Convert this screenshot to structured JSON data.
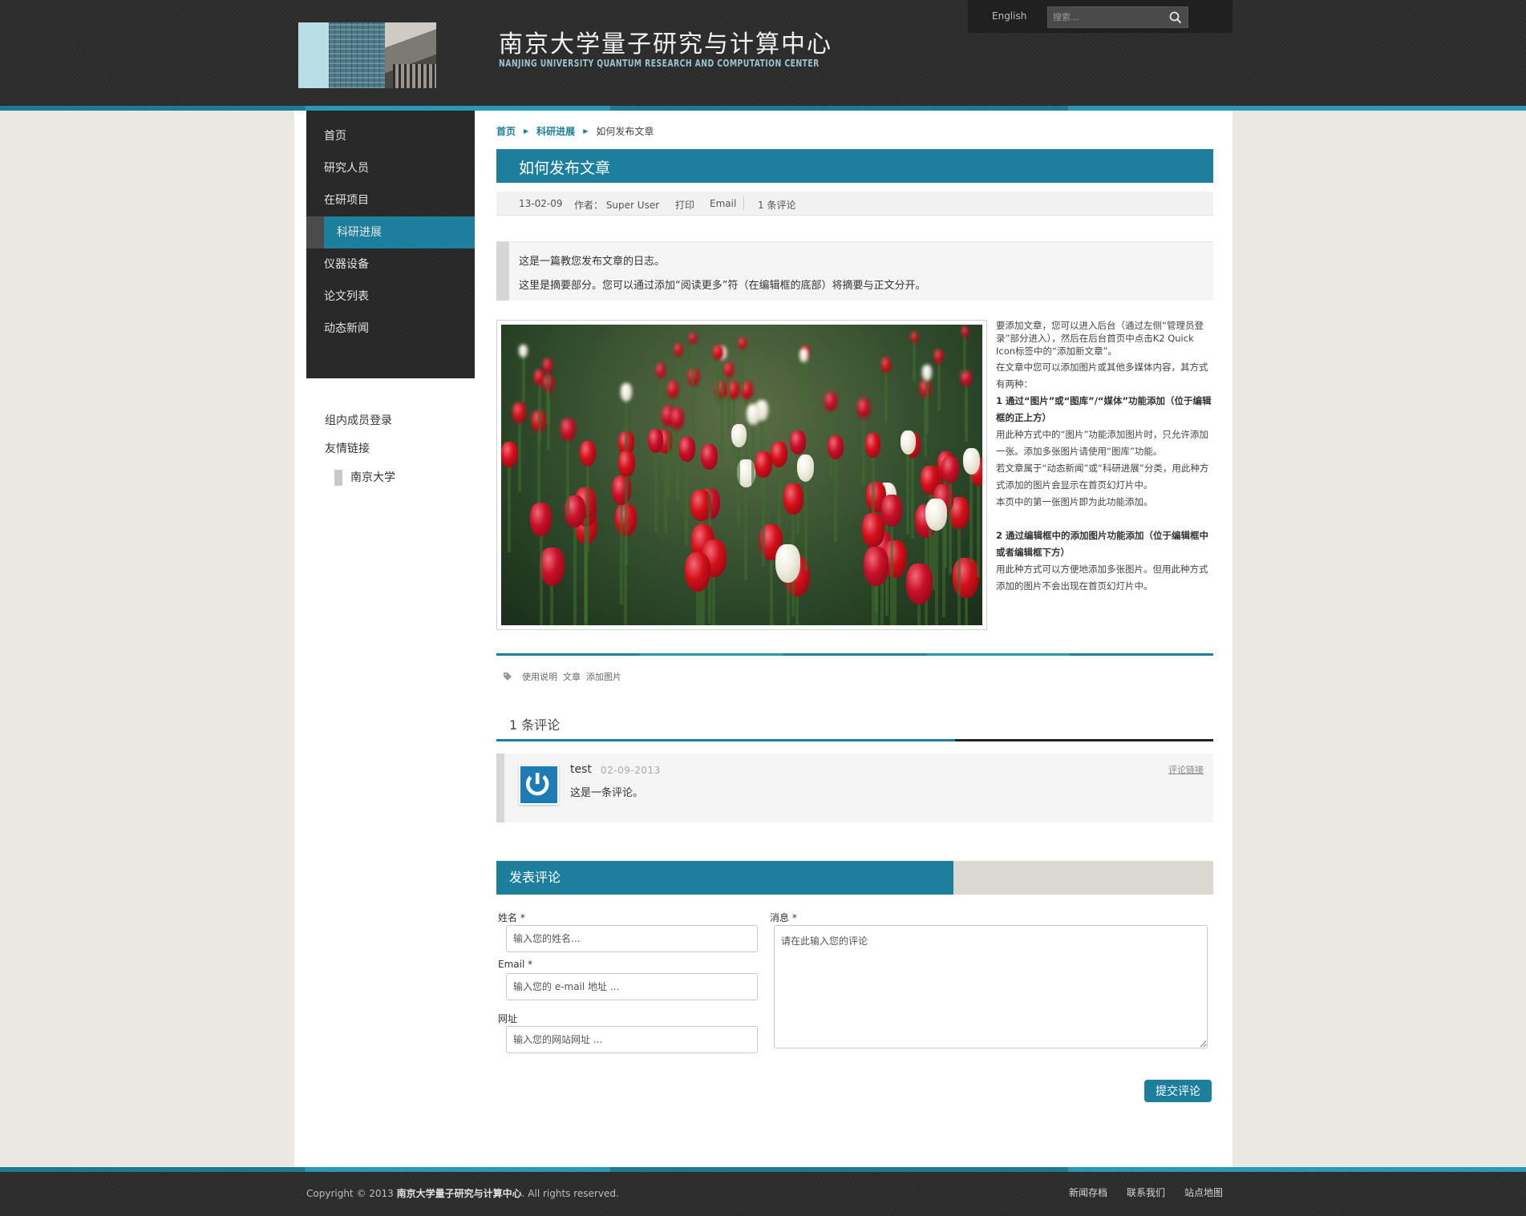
{
  "header": {
    "title": "南京大学量子研究与计算中心",
    "subtitle": "NANJING UNIVERSITY QUANTUM RESEARCH AND COMPUTATION CENTER",
    "lang_link": "English",
    "search_placeholder": "搜索..."
  },
  "sidebar": {
    "items": [
      {
        "label": "首页"
      },
      {
        "label": "研究人员"
      },
      {
        "label": "在研项目"
      },
      {
        "label": "科研进展",
        "active": true
      },
      {
        "label": "仪器设备"
      },
      {
        "label": "论文列表"
      },
      {
        "label": "动态新闻"
      }
    ],
    "links": [
      "组内成员登录",
      "友情链接"
    ],
    "sublink": "南京大学"
  },
  "breadcrumb": {
    "home": "首页",
    "section": "科研进展",
    "current": "如何发布文章"
  },
  "article": {
    "title": "如何发布文章",
    "date": "13-02-09",
    "author": "作者： Super User",
    "print": "打印",
    "email": "Email",
    "comments_count": "1 条评论",
    "intro_line1": "这是一篇教您发布文章的日志。",
    "intro_line2": "这里是摘要部分。您可以通过添加“阅读更多”符（在编辑框的底部）将摘要与正文分开。",
    "body": [
      "要添加文章，您可以进入后台（通过左侧“管理员登录”部分进入），然后在后台首页中点击K2 Quick Icon标签中的“添加新文章”。",
      "在文章中您可以添加图片或其他多媒体内容，其方式有两种：",
      "1 通过“图片”或“图库”/“媒体”功能添加（位于编辑框的正上方）",
      "用此种方式中的“图片”功能添加图片时，只允许添加一张。添加多张图片请使用“图库”功能。",
      "若文章属于“动态新闻”或“科研进展”分类，用此种方式添加的图片会显示在首页幻灯片中。",
      "本页中的第一张图片即为此功能添加。",
      "2 通过编辑框中的添加图片功能添加（位于编辑框中或者编辑框下方）",
      "用此种方式可以方便地添加多张图片。但用此种方式添加的图片不会出现在首页幻灯片中。"
    ],
    "tags": [
      "使用说明",
      "文章",
      "添加图片"
    ]
  },
  "comments": {
    "heading": "1 条评论",
    "items": [
      {
        "author": "test",
        "date": "02-09-2013",
        "text": "这是一条评论。",
        "link": "评论链接"
      }
    ]
  },
  "form": {
    "title": "发表评论",
    "name_label": "姓名 *",
    "name_placeholder": "输入您的姓名...",
    "email_label": "Email *",
    "email_placeholder": "输入您的 e-mail 地址 ...",
    "url_label": "网址",
    "url_placeholder": "输入您的网站网址 ...",
    "message_label": "消息 *",
    "message_placeholder": "请在此输入您的评论",
    "submit": "提交评论"
  },
  "footer": {
    "copyright_prefix": "Copyright © 2013",
    "copyright_name": "南京大学量子研究与计算中心",
    "copyright_suffix": ". All rights reserved.",
    "links": [
      "新闻存档",
      "联系我们",
      "站点地图"
    ]
  },
  "colors": {
    "accent": "#1e7f9c",
    "header_bg": "#2b2b2b",
    "page_bg": "#ebe8e3"
  }
}
